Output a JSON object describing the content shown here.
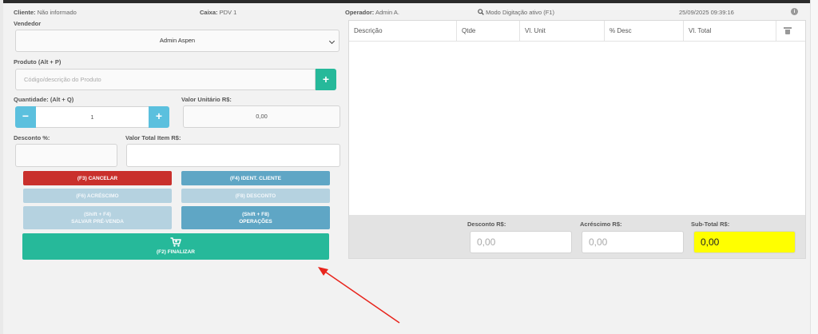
{
  "header": {
    "cliente_label": "Cliente:",
    "cliente_value": "Não informado",
    "caixa_label": "Caixa:",
    "caixa_value": "PDV 1",
    "operador_label": "Operador:",
    "operador_value": "Admin A.",
    "modo": "Modo Digitação ativo (F1)",
    "datetime": "25/09/2025 09:39:16",
    "info_glyph": "i"
  },
  "form": {
    "vendedor_label": "Vendedor",
    "vendedor_value": "Admin Aspen",
    "produto_label": "Produto (Alt + P)",
    "produto_placeholder": "Código/descrição do Produto",
    "add_glyph": "+",
    "quantidade_label": "Quantidade: (Alt + Q)",
    "minus_glyph": "−",
    "plus_glyph": "+",
    "quantidade_value": "1",
    "valor_unitario_label": "Valor Unitário R$:",
    "valor_unitario_value": "0,00",
    "desconto_label": "Desconto %:",
    "valor_total_item_label": "Valor Total Item R$:"
  },
  "actions": {
    "cancelar": "(F3) CANCELAR",
    "ident_cliente": "(F4) IDENT. CLIENTE",
    "acrescimo": "(F6) ACRÉSCIMO",
    "desconto": "(F8) DESCONTO",
    "salvar_l1": "(Shift + F4)",
    "salvar_l2": "SALVAR PRÉ-VENDA",
    "operacoes_l1": "(Shift + F8)",
    "operacoes_l2": "OPERAÇÕES",
    "finalizar": "(F2) FINALIZAR"
  },
  "table": {
    "columns": [
      "Descrição",
      "Qtde",
      "Vl. Unit",
      "% Desc",
      "Vl. Total"
    ]
  },
  "totals": {
    "desconto_label": "Desconto R$:",
    "desconto_value": "0,00",
    "acrescimo_label": "Acréscimo R$:",
    "acrescimo_value": "0,00",
    "subtotal_label": "Sub-Total R$:",
    "subtotal_value": "0,00"
  },
  "colors": {
    "accent_green": "#26b99a",
    "danger_red": "#c9302c",
    "info_blue": "#5fa6c5",
    "qty_blue": "#5bc0de",
    "subtotal_yellow": "#ffff00",
    "annotation_red": "#e8241c"
  },
  "icons": [
    "search-icon",
    "info-icon",
    "chevron-down-icon",
    "trash-icon",
    "cart-icon"
  ]
}
